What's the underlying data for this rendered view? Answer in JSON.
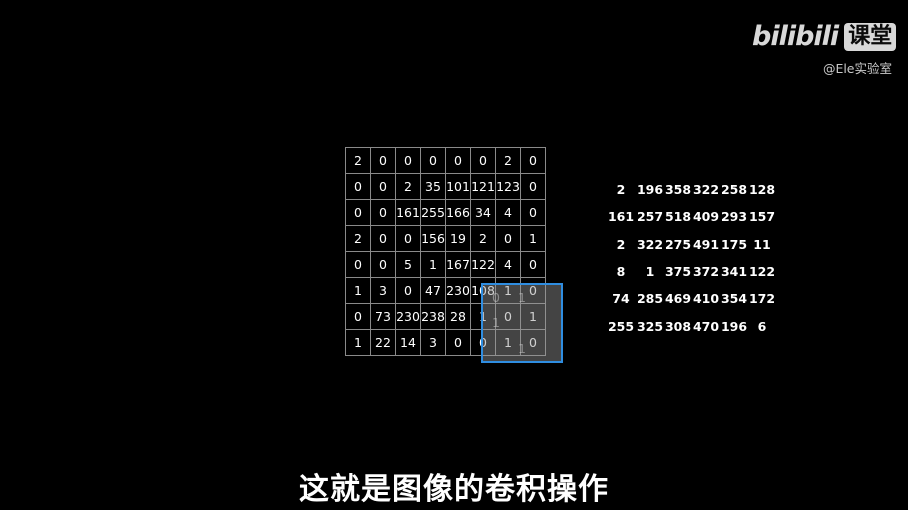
{
  "logo": {
    "brand": "bilibili",
    "badge": "课堂"
  },
  "channel": "@Ele实验室",
  "input_matrix": [
    [
      "2",
      "0",
      "0",
      "0",
      "0",
      "0",
      "2",
      "0"
    ],
    [
      "0",
      "0",
      "2",
      "35",
      "101",
      "121",
      "123",
      "0"
    ],
    [
      "0",
      "0",
      "161",
      "255",
      "166",
      "34",
      "4",
      "0"
    ],
    [
      "2",
      "0",
      "0",
      "156",
      "19",
      "2",
      "0",
      "1"
    ],
    [
      "0",
      "0",
      "5",
      "1",
      "167",
      "122",
      "4",
      "0"
    ],
    [
      "1",
      "3",
      "0",
      "47",
      "230",
      "108",
      "1",
      "0"
    ],
    [
      "0",
      "73",
      "230",
      "238",
      "28",
      "1",
      "0",
      "1"
    ],
    [
      "1",
      "22",
      "14",
      "3",
      "0",
      "0",
      "1",
      "0"
    ]
  ],
  "kernel": [
    [
      "0",
      "1",
      ""
    ],
    [
      "1",
      "",
      ""
    ],
    [
      "",
      "1",
      ""
    ]
  ],
  "output_matrix": [
    [
      "2",
      "196",
      "358",
      "322",
      "258",
      "128"
    ],
    [
      "161",
      "257",
      "518",
      "409",
      "293",
      "157"
    ],
    [
      "2",
      "322",
      "275",
      "491",
      "175",
      "11"
    ],
    [
      "8",
      "1",
      "375",
      "372",
      "341",
      "122"
    ],
    [
      "74",
      "285",
      "469",
      "410",
      "354",
      "172"
    ],
    [
      "255",
      "325",
      "308",
      "470",
      "196",
      "6"
    ]
  ],
  "subtitle": "这就是图像的卷积操作",
  "colors": {
    "background": "#000000",
    "kernel_border": "#2f8de0",
    "grid_line": "#8a8a8a",
    "text": "#ffffff"
  }
}
